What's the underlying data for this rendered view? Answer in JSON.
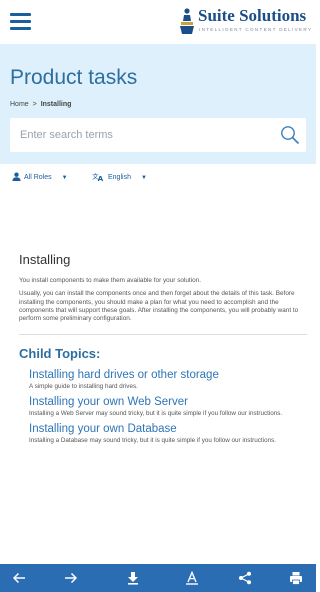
{
  "header": {
    "menu_icon": "hamburger-icon",
    "logo": {
      "name": "Suite Solutions",
      "tagline": "INTELLIGENT CONTENT DELIVERY"
    }
  },
  "hero": {
    "title": "Product tasks",
    "breadcrumb": {
      "home": "Home",
      "separator": ">",
      "current": "Installing"
    },
    "search": {
      "placeholder": "Enter search terms",
      "icon": "search-icon"
    }
  },
  "filters": {
    "roles": {
      "label": "All Roles",
      "icon": "person-icon"
    },
    "language": {
      "label": "English",
      "icon": "translate-icon"
    }
  },
  "topic": {
    "title": "Installing",
    "paragraphs": [
      "You install components to make them available for your solution.",
      "Usually, you can install the components once and then forget about the details of this task. Before installing the components, you should make a plan for what you need to accomplish and the components that will support these goals. After installing the components, you will probably want to perform some preliminary configuration."
    ],
    "child_heading": "Child Topics:",
    "children": [
      {
        "title": "Installing hard drives or other storage",
        "desc": "A simple guide to installing hard drives."
      },
      {
        "title": "Installing your own Web Server",
        "desc": "Installing a Web Server may sound tricky, but it is quite simple if you follow our instructions."
      },
      {
        "title": "Installing your own Database",
        "desc": "Installing a Database may sound tricky, but it is quite simple if you follow our instructions."
      }
    ]
  },
  "toolbar": {
    "icons": [
      "back-arrow-icon",
      "forward-arrow-icon",
      "download-icon",
      "font-size-icon",
      "share-icon",
      "print-icon"
    ]
  },
  "colors": {
    "brand_blue": "#2a6db2",
    "hero_bg": "#ddf0fb",
    "title_blue": "#2e6e9e",
    "link_blue": "#2e75b6"
  }
}
